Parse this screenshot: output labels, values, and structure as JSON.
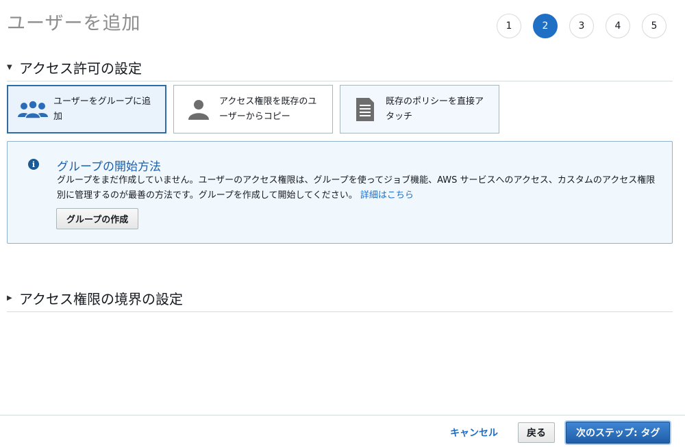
{
  "page": {
    "title": "ユーザーを追加"
  },
  "steps": [
    "1",
    "2",
    "3",
    "4",
    "5"
  ],
  "active_step": 2,
  "permissions_section": {
    "title": "アクセス許可の設定",
    "options": [
      {
        "label": "ユーザーをグループに追加",
        "icon": "users-group-icon",
        "selected": true
      },
      {
        "label": "アクセス権限を既存のユーザーからコピー",
        "icon": "user-icon",
        "selected": false
      },
      {
        "label": "既存のポリシーを直接アタッチ",
        "icon": "document-icon",
        "selected": false
      }
    ]
  },
  "info": {
    "icon": "info-icon",
    "title": "グループの開始方法",
    "body": "グループをまだ作成していません。ユーザーのアクセス権限は、グループを使ってジョブ機能、AWS サービスへのアクセス、カスタムのアクセス権限別に管理するのが最善の方法です。グループを作成して開始してください。",
    "link_text": "詳細はこちら",
    "button_label": "グループの作成"
  },
  "boundary_section": {
    "title": "アクセス権限の境界の設定"
  },
  "footer": {
    "cancel_label": "キャンセル",
    "back_label": "戻る",
    "next_label": "次のステップ: タグ"
  },
  "colors": {
    "primary": "#1f6fc5",
    "selected_border": "#2e6da4",
    "info_bg": "#f1f8fd"
  }
}
